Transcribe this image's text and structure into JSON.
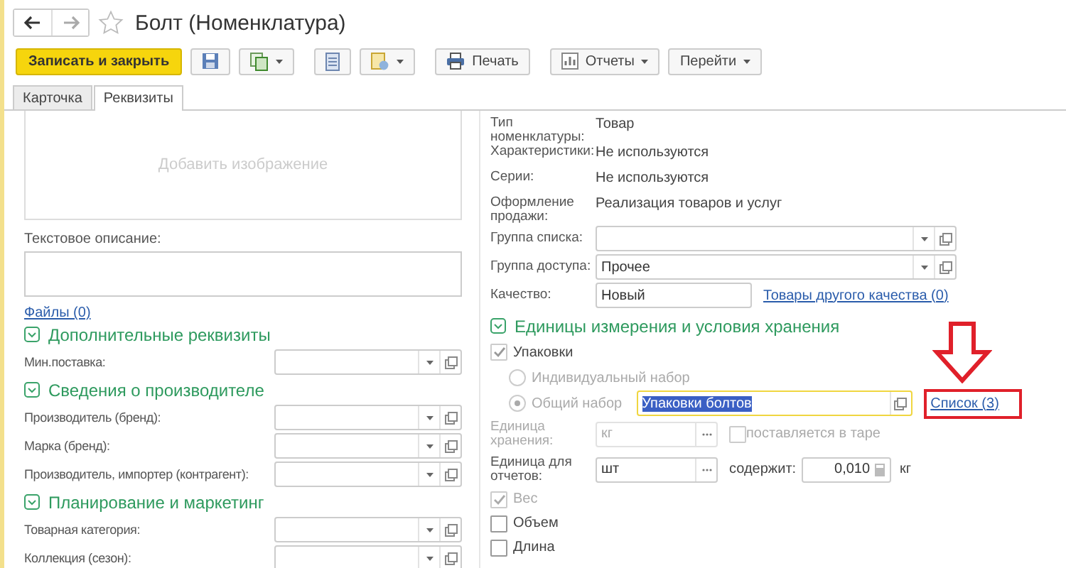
{
  "window": {
    "title": "Болт (Номенклатура)"
  },
  "toolbar": [
    {
      "kind": "primary",
      "label": "Записать и закрыть",
      "dropdown": false
    },
    {
      "kind": "save",
      "dropdown": false
    },
    {
      "kind": "copy",
      "dropdown": true
    },
    {
      "kind": "list",
      "dropdown": false
    },
    {
      "kind": "document",
      "dropdown": true
    },
    {
      "kind": "print",
      "label": "Печать",
      "dropdown": false
    },
    {
      "kind": "reports",
      "label": "Отчеты",
      "dropdown": true
    },
    {
      "kind": "text",
      "label": "Перейти",
      "dropdown": true
    }
  ],
  "tabs": [
    {
      "label": "Карточка",
      "selected": false
    },
    {
      "label": "Реквизиты",
      "selected": true
    }
  ],
  "image": {
    "placeholder": "Добавить изображение"
  },
  "description": {
    "label": "Текстовое описание:"
  },
  "files_link": "Файлы (0)",
  "left_sections": [
    {
      "title": "Дополнительные реквизиты",
      "expanded": true,
      "fields": [
        {
          "label": "Мин.поставка:"
        }
      ]
    },
    {
      "title": "Сведения о производителе",
      "expanded": true,
      "fields": [
        {
          "label": "Производитель (бренд):"
        },
        {
          "label": "Марка (бренд):"
        },
        {
          "label": "Производитель, импортер (контрагент):"
        }
      ]
    },
    {
      "title": "Планирование и маркетинг",
      "expanded": true,
      "fields": [
        {
          "label": "Товарная категория:"
        },
        {
          "label": "Коллекция (сезон):"
        }
      ]
    }
  ],
  "right": {
    "info": [
      {
        "label": "Тип номенклатуры:",
        "value": "Товар"
      },
      {
        "label": "Характеристики:",
        "value": "Не используются"
      },
      {
        "label": "Серии:",
        "value": "Не используются"
      },
      {
        "label": "Оформление продажи:",
        "value": "Реализация товаров и услуг"
      }
    ],
    "selects": [
      {
        "label": "Группа списка:"
      },
      {
        "label": "Группа доступа:",
        "value": "Прочее"
      }
    ],
    "quality": {
      "label": "Качество:",
      "value": "Новый",
      "link": "Товары другого качества (0)"
    },
    "units_section": {
      "title": "Единицы измерения и условия хранения",
      "expanded": true,
      "packages": {
        "label": "Упаковки",
        "checked": true
      },
      "package_modes": [
        {
          "label": "Индивидуальный набор",
          "selected": false
        },
        {
          "label": "Общий набор",
          "selected": true
        }
      ],
      "package_set": {
        "value": "Упаковки болтов",
        "text_selected": true
      },
      "list_link": {
        "label": "Список (3)",
        "highlighted": true
      },
      "storage_unit": {
        "label": "Единица хранения:",
        "value": "кг",
        "disabled": true
      },
      "tare": {
        "label": "поставляется в таре",
        "checked": false,
        "disabled": true
      },
      "report_unit": {
        "label": "Единица для отчетов:",
        "value": "шт",
        "contains_label": "содержит:",
        "contains_value": "0,010",
        "unit": "кг"
      },
      "measures": [
        {
          "label": "Вес",
          "checked": true,
          "disabled": true
        },
        {
          "label": "Объем",
          "checked": false,
          "disabled": false
        },
        {
          "label": "Длина",
          "checked": false,
          "disabled": false
        }
      ]
    }
  }
}
